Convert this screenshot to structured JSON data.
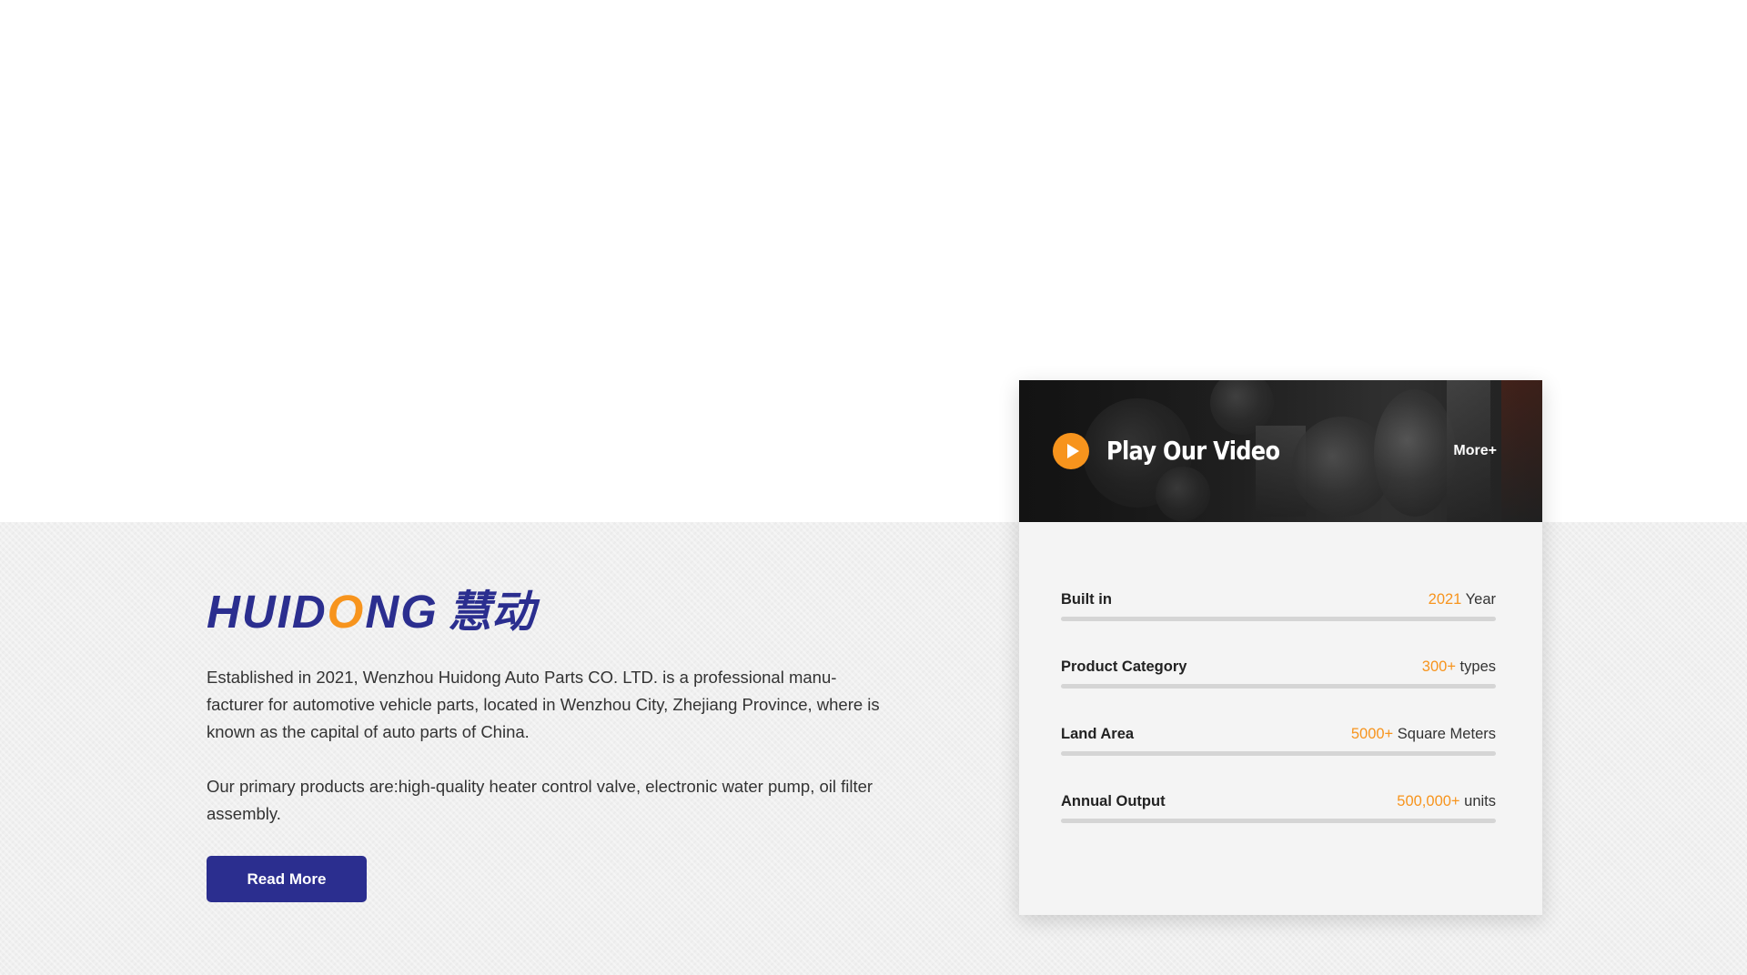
{
  "brand": {
    "logo_latin_pre": "HUID",
    "logo_latin_o": "O",
    "logo_latin_post": "NG",
    "logo_cjk": "慧动",
    "primary_color": "#2b2e8f",
    "accent_color": "#f7941d"
  },
  "intro": {
    "paragraph_1": "Established in 2021, Wenzhou Huidong Auto Parts CO. LTD. is a professional manu-facturer for automotive vehicle parts, located in Wenzhou City, Zhejiang Province, where is known as the capital of auto parts of China.",
    "paragraph_2": "Our primary products are:high-quality heater control valve, electronic water pump, oil filter assembly.",
    "read_more_label": "Read More"
  },
  "video": {
    "title": "Play Our Video",
    "more_label": "More+",
    "play_icon": "play-icon"
  },
  "stats": [
    {
      "label": "Built in",
      "number": "2021",
      "unit": " Year"
    },
    {
      "label": "Product Category",
      "number": "300+",
      "unit": " types"
    },
    {
      "label": "Land Area",
      "number": "5000+",
      "unit": " Square Meters"
    },
    {
      "label": "Annual Output",
      "number": "500,000+",
      "unit": " units"
    }
  ]
}
